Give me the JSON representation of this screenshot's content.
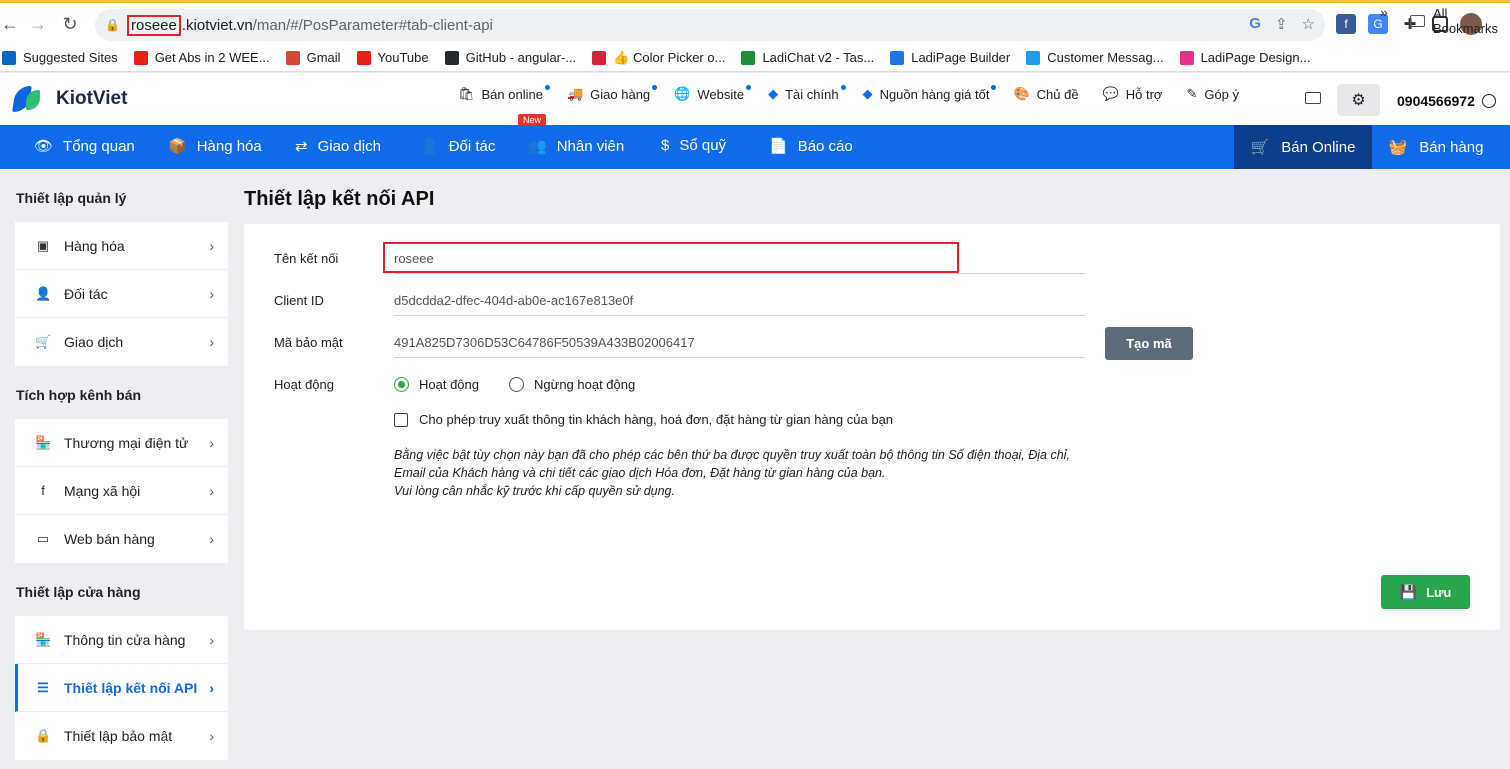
{
  "browser": {
    "url_host_highlight": "roseee",
    "url_rest_host": ".kiotviet.vn",
    "url_path": "/man/#/PosParameter#tab-client-api",
    "bookmarks": [
      {
        "label": "Suggested Sites",
        "icon": "bing-icon",
        "color": "#0a66c2"
      },
      {
        "label": "Get Abs in 2 WEE...",
        "icon": "youtube-icon",
        "color": "#e62117"
      },
      {
        "label": "Gmail",
        "icon": "gmail-icon",
        "color": "#d44638"
      },
      {
        "label": "YouTube",
        "icon": "youtube-icon",
        "color": "#e62117"
      },
      {
        "label": "GitHub - angular-...",
        "icon": "github-icon",
        "color": "#24292e"
      },
      {
        "label": "👍 Color Picker o...",
        "icon": "color-picker-icon",
        "color": "#d6233a"
      },
      {
        "label": "LadiChat v2 - Tas...",
        "icon": "sheet-icon",
        "color": "#1e8e3e"
      },
      {
        "label": "LadiPage Builder",
        "icon": "ladipage-icon",
        "color": "#1a73e8"
      },
      {
        "label": "Customer Messag...",
        "icon": "messenger-icon",
        "color": "#1a9cf5"
      },
      {
        "label": "LadiPage Design...",
        "icon": "ladipage-icon",
        "color": "#e8318a"
      }
    ],
    "all_bookmarks": "All Bookmarks"
  },
  "header": {
    "logo": "KiotViet",
    "top_menu": [
      {
        "label": "Bán online",
        "icon": "bag-icon",
        "dot": true
      },
      {
        "label": "Giao hàng",
        "icon": "truck-icon",
        "dot": true
      },
      {
        "label": "Website",
        "icon": "globe-icon",
        "dot": true
      },
      {
        "label": "Tài chính",
        "icon": "kv-finance-icon",
        "dot": true
      },
      {
        "label": "Nguồn hàng giá tốt",
        "icon": "kv-source-icon",
        "dot": true
      },
      {
        "label": "Chủ đề",
        "icon": "palette-icon",
        "dot": false
      },
      {
        "label": "Hỗ trợ",
        "icon": "chat-icon",
        "dot": false
      },
      {
        "label": "Góp ý",
        "icon": "feedback-icon",
        "dot": false
      }
    ],
    "new_badge": "New",
    "phone": "0904566972"
  },
  "nav": {
    "items": [
      {
        "label": "Tổng quan",
        "icon": "eye-icon"
      },
      {
        "label": "Hàng hóa",
        "icon": "box-icon"
      },
      {
        "label": "Giao dịch",
        "icon": "exchange-icon"
      },
      {
        "label": "Đối tác",
        "icon": "person-icon"
      },
      {
        "label": "Nhân viên",
        "icon": "users-icon"
      },
      {
        "label": "Sổ quỹ",
        "icon": "dollar-icon"
      },
      {
        "label": "Báo cáo",
        "icon": "report-icon"
      }
    ],
    "online": "Bán Online",
    "sell": "Bán hàng"
  },
  "sidebar": {
    "sections": [
      {
        "title": "Thiết lập quản lý",
        "items": [
          {
            "label": "Hàng hóa",
            "icon": "box-icon"
          },
          {
            "label": "Đối tác",
            "icon": "person-icon"
          },
          {
            "label": "Giao dịch",
            "icon": "cart-icon"
          }
        ]
      },
      {
        "title": "Tích hợp kênh bán",
        "items": [
          {
            "label": "Thương mại điện tử",
            "icon": "store-icon"
          },
          {
            "label": "Mạng xã hội",
            "icon": "facebook-icon"
          },
          {
            "label": "Web bán hàng",
            "icon": "web-icon"
          }
        ]
      },
      {
        "title": "Thiết lập cửa hàng",
        "items": [
          {
            "label": "Thông tin cửa hàng",
            "icon": "store-icon"
          },
          {
            "label": "Thiết lập kết nối API",
            "icon": "sliders-icon",
            "active": true
          },
          {
            "label": "Thiết lập bảo mật",
            "icon": "user-lock-icon"
          }
        ]
      }
    ]
  },
  "main": {
    "title": "Thiết lập kết nối API",
    "fields": {
      "name_label": "Tên kết nối",
      "name_value": "roseee",
      "client_id_label": "Client ID",
      "client_id_value": "d5dcdda2-dfec-404d-ab0e-ac167e813e0f",
      "secret_label": "Mã bảo mật",
      "secret_value": "491A825D7306D53C64786F50539A433B02006417",
      "status_label": "Hoạt động"
    },
    "generate_button": "Tạo mã",
    "radio_active": "Hoạt động",
    "radio_inactive": "Ngừng hoạt động",
    "checkbox_label": "Cho phép truy xuất thông tin khách hàng, hoá đơn, đặt hàng từ gian hàng của bạn",
    "note_line1": "Bằng việc bật tùy chọn này bạn đã cho phép các bên thứ ba được quyền truy xuất toàn bộ thông tin Số điện thoại, Địa chỉ, Email của Khách hàng và chi tiết các giao dịch Hóa đơn, Đặt hàng từ gian hàng của bạn.",
    "note_line2": "Vui lòng cân nhắc kỹ trước khi cấp quyền sử dụng.",
    "save_button": "Lưu"
  },
  "colors": {
    "accent": "#0f6bea",
    "nav_online": "#0d3e8a",
    "success": "#27a64b",
    "highlight": "#e0232a"
  }
}
